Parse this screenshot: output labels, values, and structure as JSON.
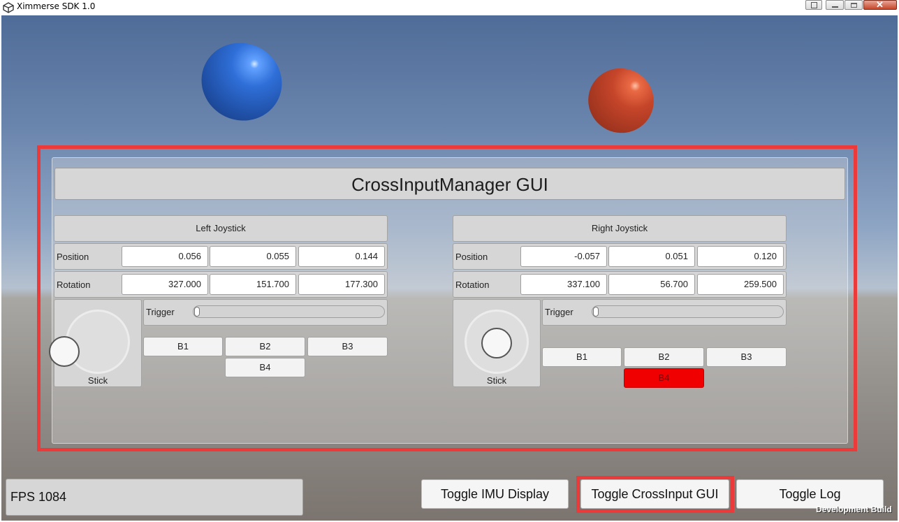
{
  "window": {
    "title": "Ximmerse SDK 1.0",
    "controls": [
      "icon-button",
      "minimize",
      "maximize",
      "close"
    ]
  },
  "gui": {
    "title": "CrossInputManager GUI"
  },
  "left": {
    "header": "Left Joystick",
    "position_label": "Position",
    "position": [
      "0.056",
      "0.055",
      "0.144"
    ],
    "rotation_label": "Rotation",
    "rotation": [
      "327.000",
      "151.700",
      "177.300"
    ],
    "stick_label": "Stick",
    "trigger_label": "Trigger",
    "trigger_value": 0,
    "buttons": [
      "B1",
      "B2",
      "B3",
      "B4"
    ],
    "pressed_buttons": []
  },
  "right": {
    "header": "Right Joystick",
    "position_label": "Position",
    "position": [
      "-0.057",
      "0.051",
      "0.120"
    ],
    "rotation_label": "Rotation",
    "rotation": [
      "337.100",
      "56.700",
      "259.500"
    ],
    "stick_label": "Stick",
    "trigger_label": "Trigger",
    "trigger_value": 0,
    "buttons": [
      "B1",
      "B2",
      "B3",
      "B4"
    ],
    "pressed_buttons": [
      "B4"
    ]
  },
  "footer": {
    "fps": "FPS 1084",
    "toggle_imu": "Toggle IMU Display",
    "toggle_crossinput": "Toggle CrossInput GUI",
    "toggle_log": "Toggle Log",
    "watermark": "Development Build"
  },
  "colors": {
    "highlight": "#ec3a3a",
    "pressed_button": "#f00000",
    "blue_sphere": "#2f6fd8",
    "red_sphere": "#c5452a"
  }
}
